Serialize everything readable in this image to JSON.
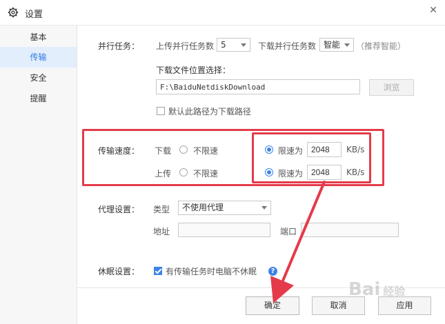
{
  "window": {
    "title": "设置",
    "close_symbol": "✕"
  },
  "sidebar": {
    "items": [
      {
        "label": "基本"
      },
      {
        "label": "传输"
      },
      {
        "label": "安全"
      },
      {
        "label": "提醒"
      }
    ],
    "active_index": 1
  },
  "parallel": {
    "section_label": "并行任务：",
    "upload_label": "上传并行任务数",
    "upload_value": "5",
    "download_label": "下载并行任务数",
    "download_value": "智能",
    "recommend_hint": "（推荐智能）"
  },
  "download_location": {
    "label": "下载文件位置选择：",
    "path": "F:\\BaiduNetdiskDownload",
    "browse_label": "浏览",
    "default_checkbox_label": "默认此路径为下载路径",
    "default_checked": false
  },
  "speed": {
    "section_label": "传输速度：",
    "download_label": "下载",
    "upload_label": "上传",
    "unlimited_label": "不限速",
    "limit_label": "限速为",
    "download_limit_value": "2048",
    "upload_limit_value": "2048",
    "unit": "KB/s"
  },
  "proxy": {
    "section_label": "代理设置：",
    "type_label": "类型",
    "type_value": "不使用代理",
    "address_label": "地址",
    "port_label": "端口",
    "address_value": "",
    "port_value": ""
  },
  "sleep": {
    "section_label": "休眠设置：",
    "checkbox_label": "有传输任务时电脑不休眠",
    "checked": true,
    "help_symbol": "?"
  },
  "footer": {
    "ok_label": "确定",
    "cancel_label": "取消",
    "apply_label": "应用"
  },
  "watermark": {
    "text": "Bai",
    "sub_text": "经验"
  },
  "colors": {
    "accent": "#3d83e6",
    "highlight_red": "#e53a4a",
    "sidebar_active_bg": "#e3eefc"
  }
}
